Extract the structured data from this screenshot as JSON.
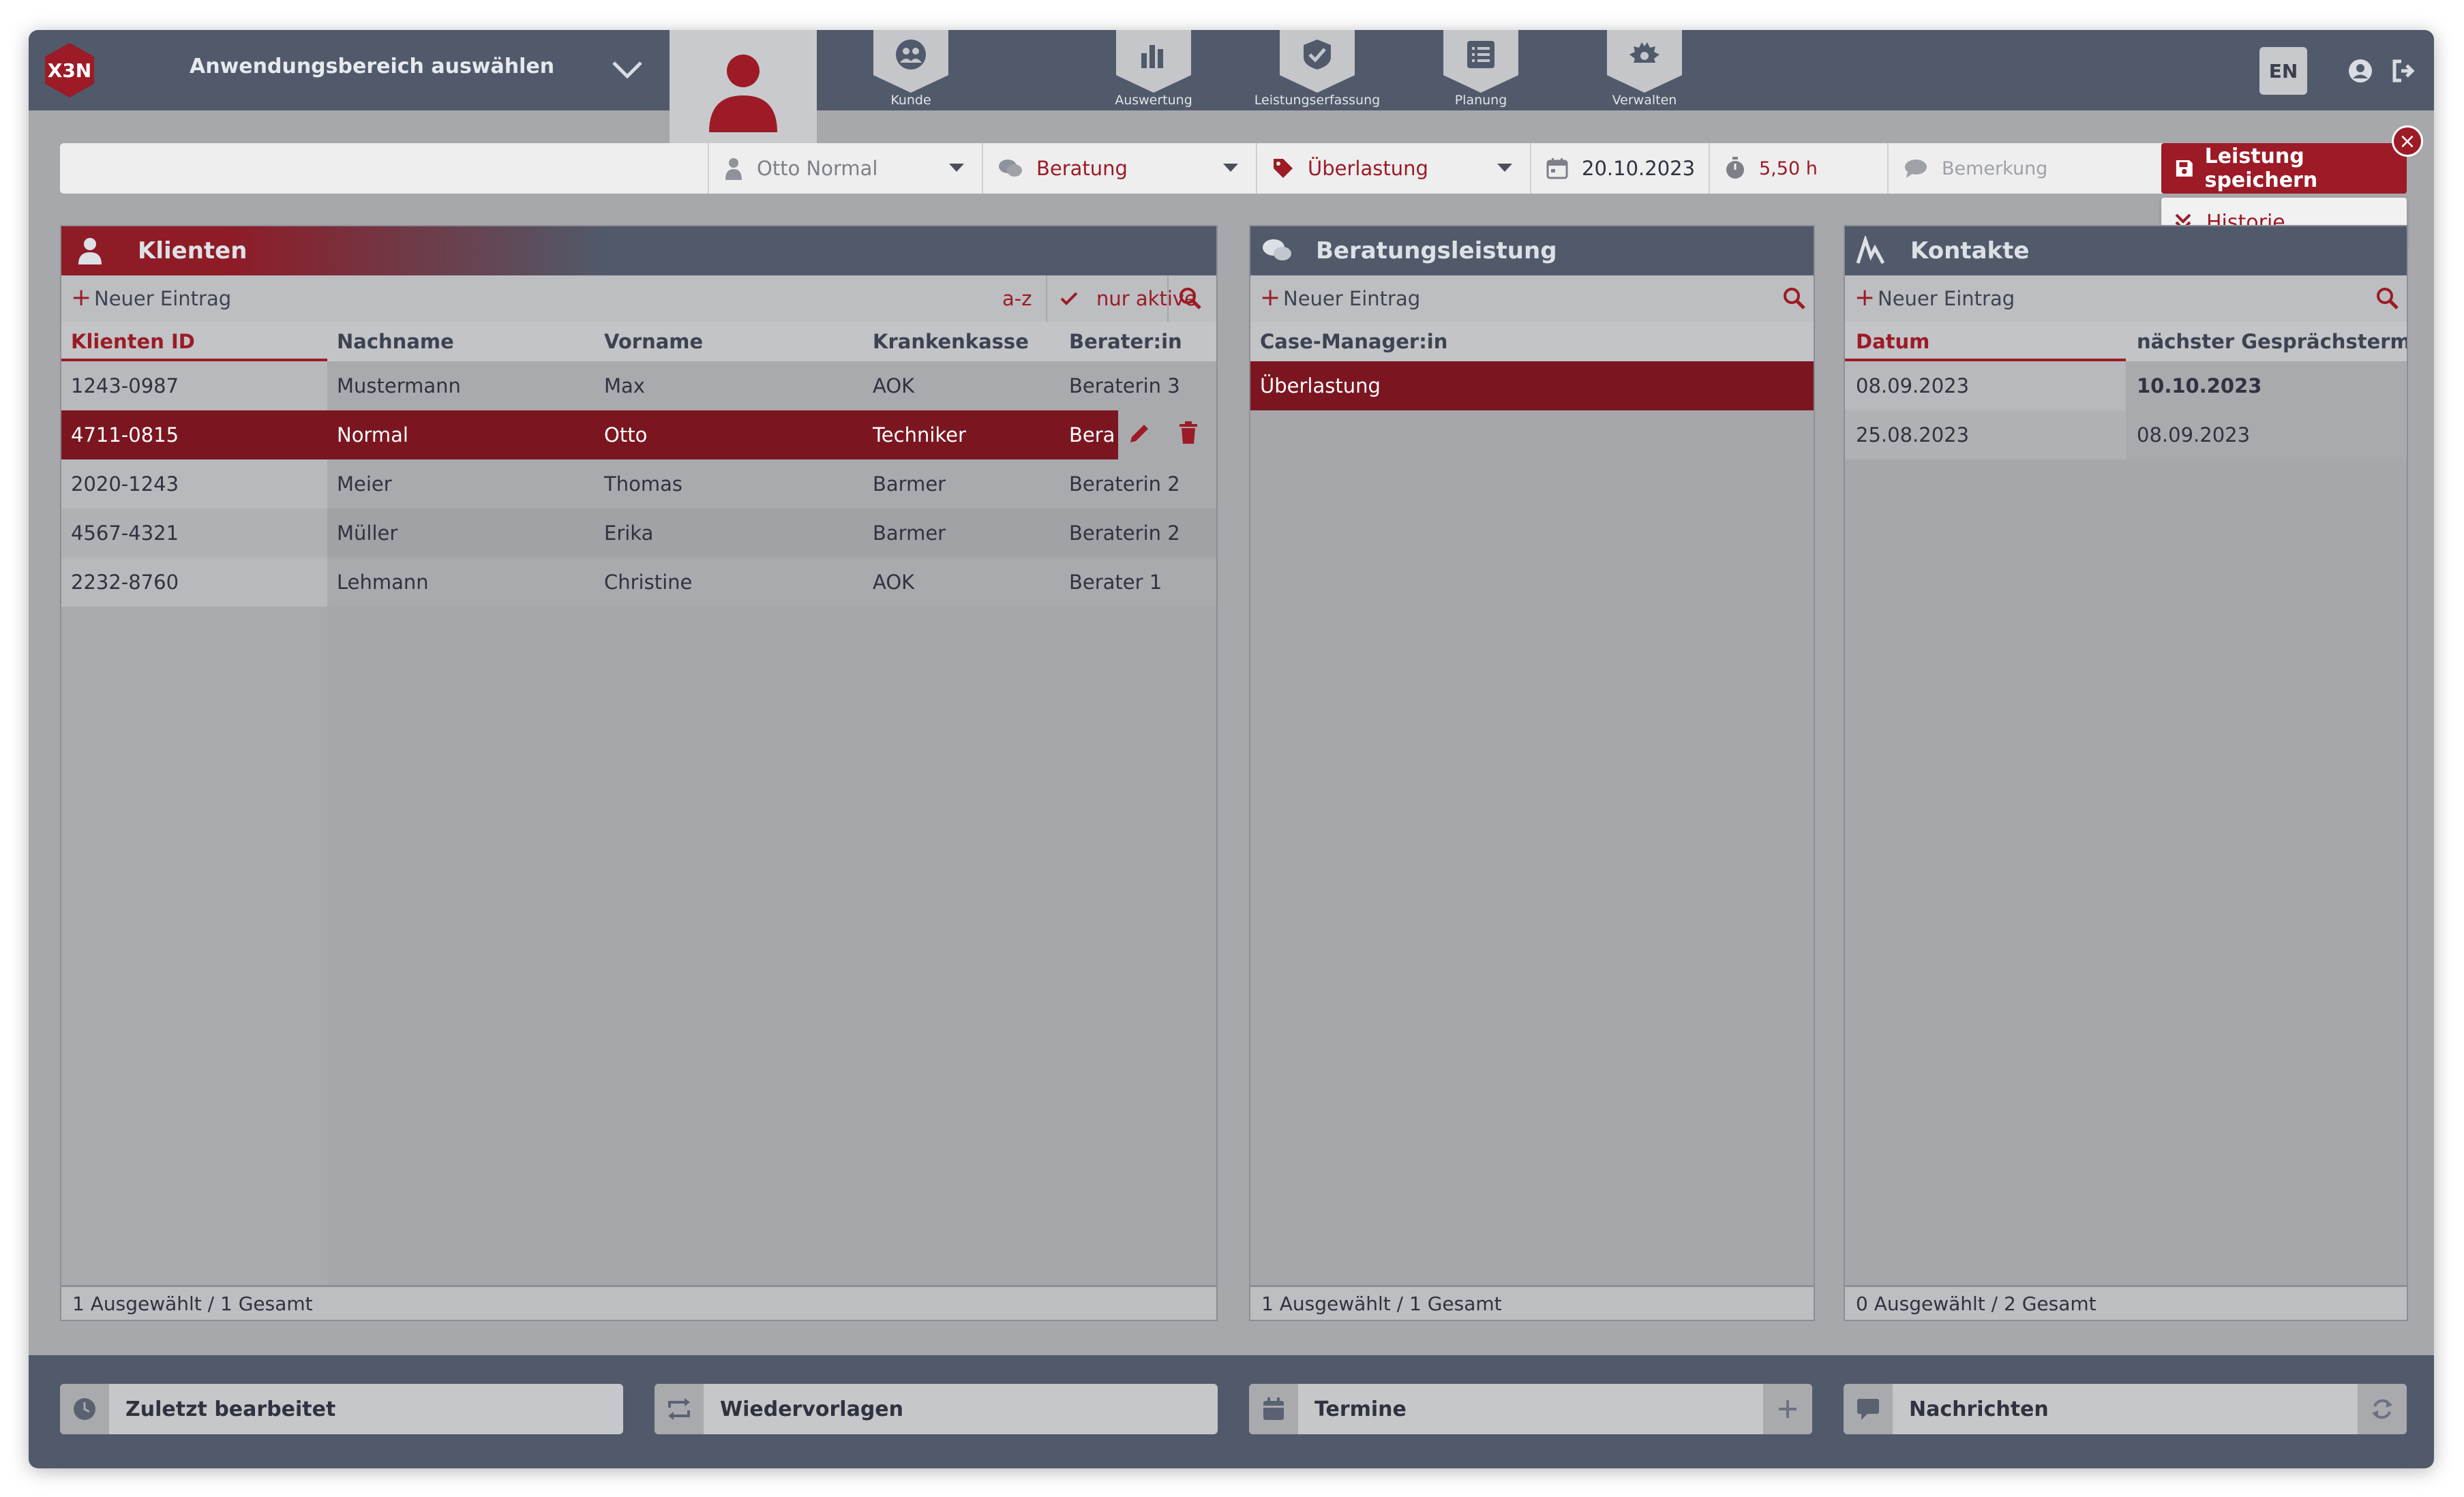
{
  "app": {
    "logo_text": "X3N",
    "area_select_label": "Anwendungsbereich auswählen",
    "language": "EN"
  },
  "nav": [
    {
      "label": "Kunde",
      "icon": "users-icon"
    },
    {
      "label": "Auswertung",
      "icon": "bar-chart-icon"
    },
    {
      "label": "Leistungserfassung",
      "icon": "checkmark-icon"
    },
    {
      "label": "Planung",
      "icon": "list-icon"
    },
    {
      "label": "Verwalten",
      "icon": "gear-icon"
    }
  ],
  "entry": {
    "client": "Otto Normal",
    "service": "Beratung",
    "tag": "Überlastung",
    "date": "20.10.2023",
    "duration": "5,50 h",
    "remark_placeholder": "Bemerkung",
    "save_label": "Leistung speichern",
    "history_label": "Historie"
  },
  "klienten": {
    "title": "Klienten",
    "new_entry": "Neuer Eintrag",
    "sort_label": "a-z",
    "filter_label": "nur aktive",
    "columns": [
      "Klienten ID",
      "Nachname",
      "Vorname",
      "Krankenkasse",
      "Berater:in"
    ],
    "rows": [
      [
        "1243-0987",
        "Mustermann",
        "Max",
        "AOK",
        "Beraterin 3"
      ],
      [
        "4711-0815",
        "Normal",
        "Otto",
        "Techniker",
        "Bera"
      ],
      [
        "2020-1243",
        "Meier",
        "Thomas",
        "Barmer",
        "Beraterin 2"
      ],
      [
        "4567-4321",
        "Müller",
        "Erika",
        "Barmer",
        "Beraterin 2"
      ],
      [
        "2232-8760",
        "Lehmann",
        "Christine",
        "AOK",
        "Berater 1"
      ]
    ],
    "footer": "1 Ausgewählt / 1 Gesamt"
  },
  "beratung": {
    "title": "Beratungsleistung",
    "new_entry": "Neuer Eintrag",
    "column": "Case-Manager:in",
    "rows": [
      "Überlastung"
    ],
    "footer": "1 Ausgewählt / 1 Gesamt"
  },
  "kontakte": {
    "title": "Kontakte",
    "new_entry": "Neuer Eintrag",
    "columns": [
      "Datum",
      "nächster Gesprächstermin"
    ],
    "rows": [
      [
        "08.09.2023",
        "10.10.2023"
      ],
      [
        "25.08.2023",
        "08.09.2023"
      ]
    ],
    "footer": "0 Ausgewählt / 2 Gesamt"
  },
  "dock": {
    "recent": "Zuletzt bearbeitet",
    "resubmissions": "Wiedervorlagen",
    "appointments": "Termine",
    "messages": "Nachrichten"
  },
  "colors": {
    "accent": "#9c1b26",
    "header": "#505a6a",
    "panel": "#a6a7ab"
  }
}
